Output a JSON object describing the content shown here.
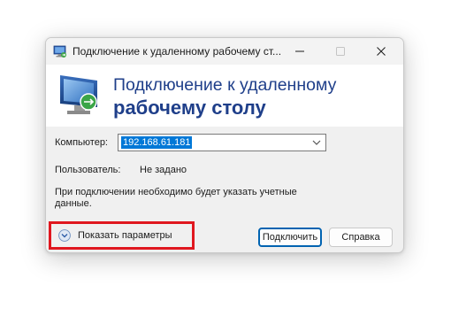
{
  "window": {
    "title": "Подключение к удаленному рабочему ст...",
    "controls": {
      "minimize": "minimize",
      "maximize": "maximize",
      "close": "close"
    }
  },
  "header": {
    "line1": "Подключение к удаленному",
    "line2": "рабочему столу",
    "icon": "remote-desktop-monitor-icon"
  },
  "form": {
    "computer_label": "Компьютер:",
    "computer_value": "192.168.61.181",
    "user_label": "Пользователь:",
    "user_value": "Не задано",
    "note": "При подключении необходимо будет указать учетные данные."
  },
  "footer": {
    "show_options": "Показать параметры",
    "connect": "Подключить",
    "help": "Справка"
  },
  "colors": {
    "accent": "#0078d7",
    "header_text": "#1f3f8a",
    "highlight": "#e0171f"
  }
}
